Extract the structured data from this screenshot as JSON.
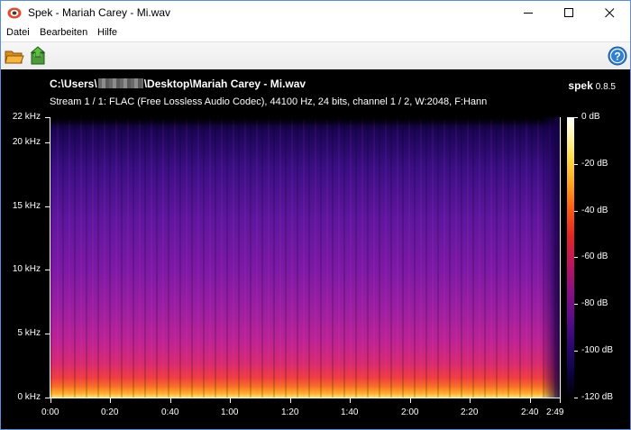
{
  "window": {
    "title": "Spek - Mariah Carey - Mi.wav",
    "app_icon": "spek-app-icon",
    "controls": [
      "minimize-icon",
      "maximize-icon",
      "close-icon"
    ]
  },
  "menu": {
    "items": [
      {
        "label": "Datei"
      },
      {
        "label": "Bearbeiten"
      },
      {
        "label": "Hilfe"
      }
    ]
  },
  "toolbar": {
    "buttons": [
      {
        "icon": "open-folder-icon"
      },
      {
        "icon": "save-arrow-icon"
      }
    ],
    "help_icon": "help-icon"
  },
  "spectrogram": {
    "path_prefix": "C:\\Users\\",
    "path_suffix": "\\Desktop\\Mariah Carey - Mi.wav",
    "brand": "spek",
    "version": "0.8.5",
    "stream_info": "Stream 1 / 1: FLAC (Free Lossless Audio Codec), 44100 Hz, 24 bits, channel 1 / 2, W:2048, F:Hann",
    "freq_ticks": [
      "22 kHz",
      "20 kHz",
      "15 kHz",
      "10 kHz",
      "5 kHz",
      "0 kHz"
    ],
    "time_ticks": [
      "0:00",
      "0:20",
      "0:40",
      "1:00",
      "1:20",
      "1:40",
      "2:00",
      "2:20",
      "2:40",
      "2:49"
    ],
    "db_ticks": [
      "0 dB",
      "-20 dB",
      "-40 dB",
      "-60 dB",
      "-80 dB",
      "-100 dB",
      "-120 dB"
    ],
    "colors": {
      "background": "#000000",
      "title_bar": "#ffffff",
      "window_border": "#5a8fd6"
    }
  }
}
